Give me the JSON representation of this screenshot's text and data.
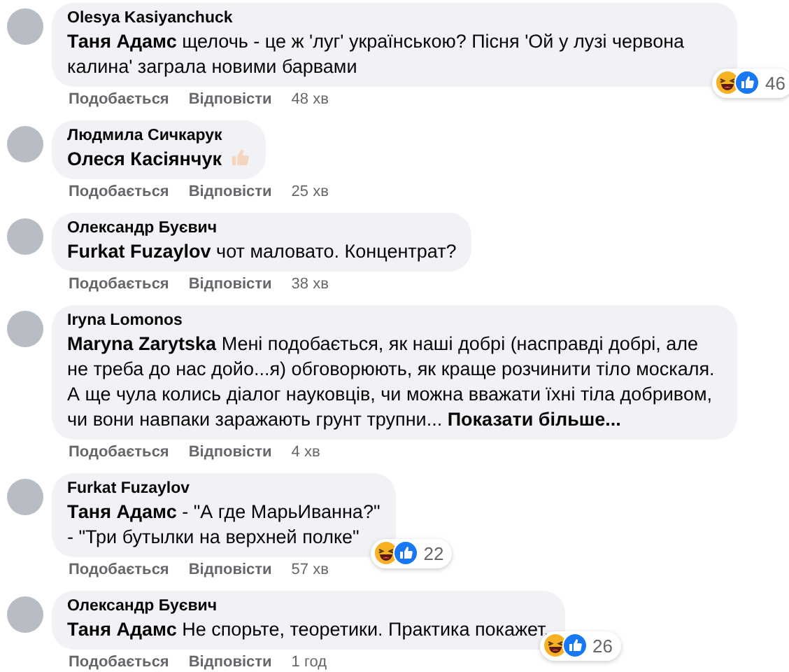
{
  "comments": [
    {
      "author": "Olesya Kasiyanchuck",
      "text": "**Таня Адамс** щелочь - це ж 'луг' українською? Пісня 'Ой у лузі червона калина' заграла новими барвами",
      "like": "Подобається",
      "reply": "Відповісти",
      "time": "48 хв",
      "reactions": "46"
    },
    {
      "author": "Людмила Сичкарук",
      "text": "**Олеся Касіянчук**",
      "thumb": true,
      "like": "Подобається",
      "reply": "Відповісти",
      "time": "25 хв"
    },
    {
      "author": "Олександр Буєвич",
      "text": "**Furkat Fuzaylov** чот маловато. Концентрат?",
      "like": "Подобається",
      "reply": "Відповісти",
      "time": "38 хв"
    },
    {
      "author": "Iryna Lomonos",
      "text": "**Maryna Zarytska** Мені подобається, як наші добрі (насправді добрі, але не треба до нас дойо...я) обговорюють, як краще розчинити тіло москаля. А ще чула колись діалог науковців, чи можна вважати їхні тіла добривом, чи вони навпаки заражають грунт трупни...",
      "more": "Показати більше...",
      "like": "Подобається",
      "reply": "Відповісти",
      "time": "4 хв"
    },
    {
      "author": "Furkat Fuzaylov",
      "text": "**Таня Адамс** - \"А где МарьИванна?\"\n- \"Три бутылки на верхней полке\"",
      "like": "Подобається",
      "reply": "Відповісти",
      "time": "57 хв",
      "reactions": "22"
    },
    {
      "author": "Олександр Буєвич",
      "text": "**Таня Адамс** Не спорьте, теоретики. Практика покажет.",
      "like": "Подобається",
      "reply": "Відповісти",
      "time": "1 год",
      "reactions": "26"
    }
  ]
}
